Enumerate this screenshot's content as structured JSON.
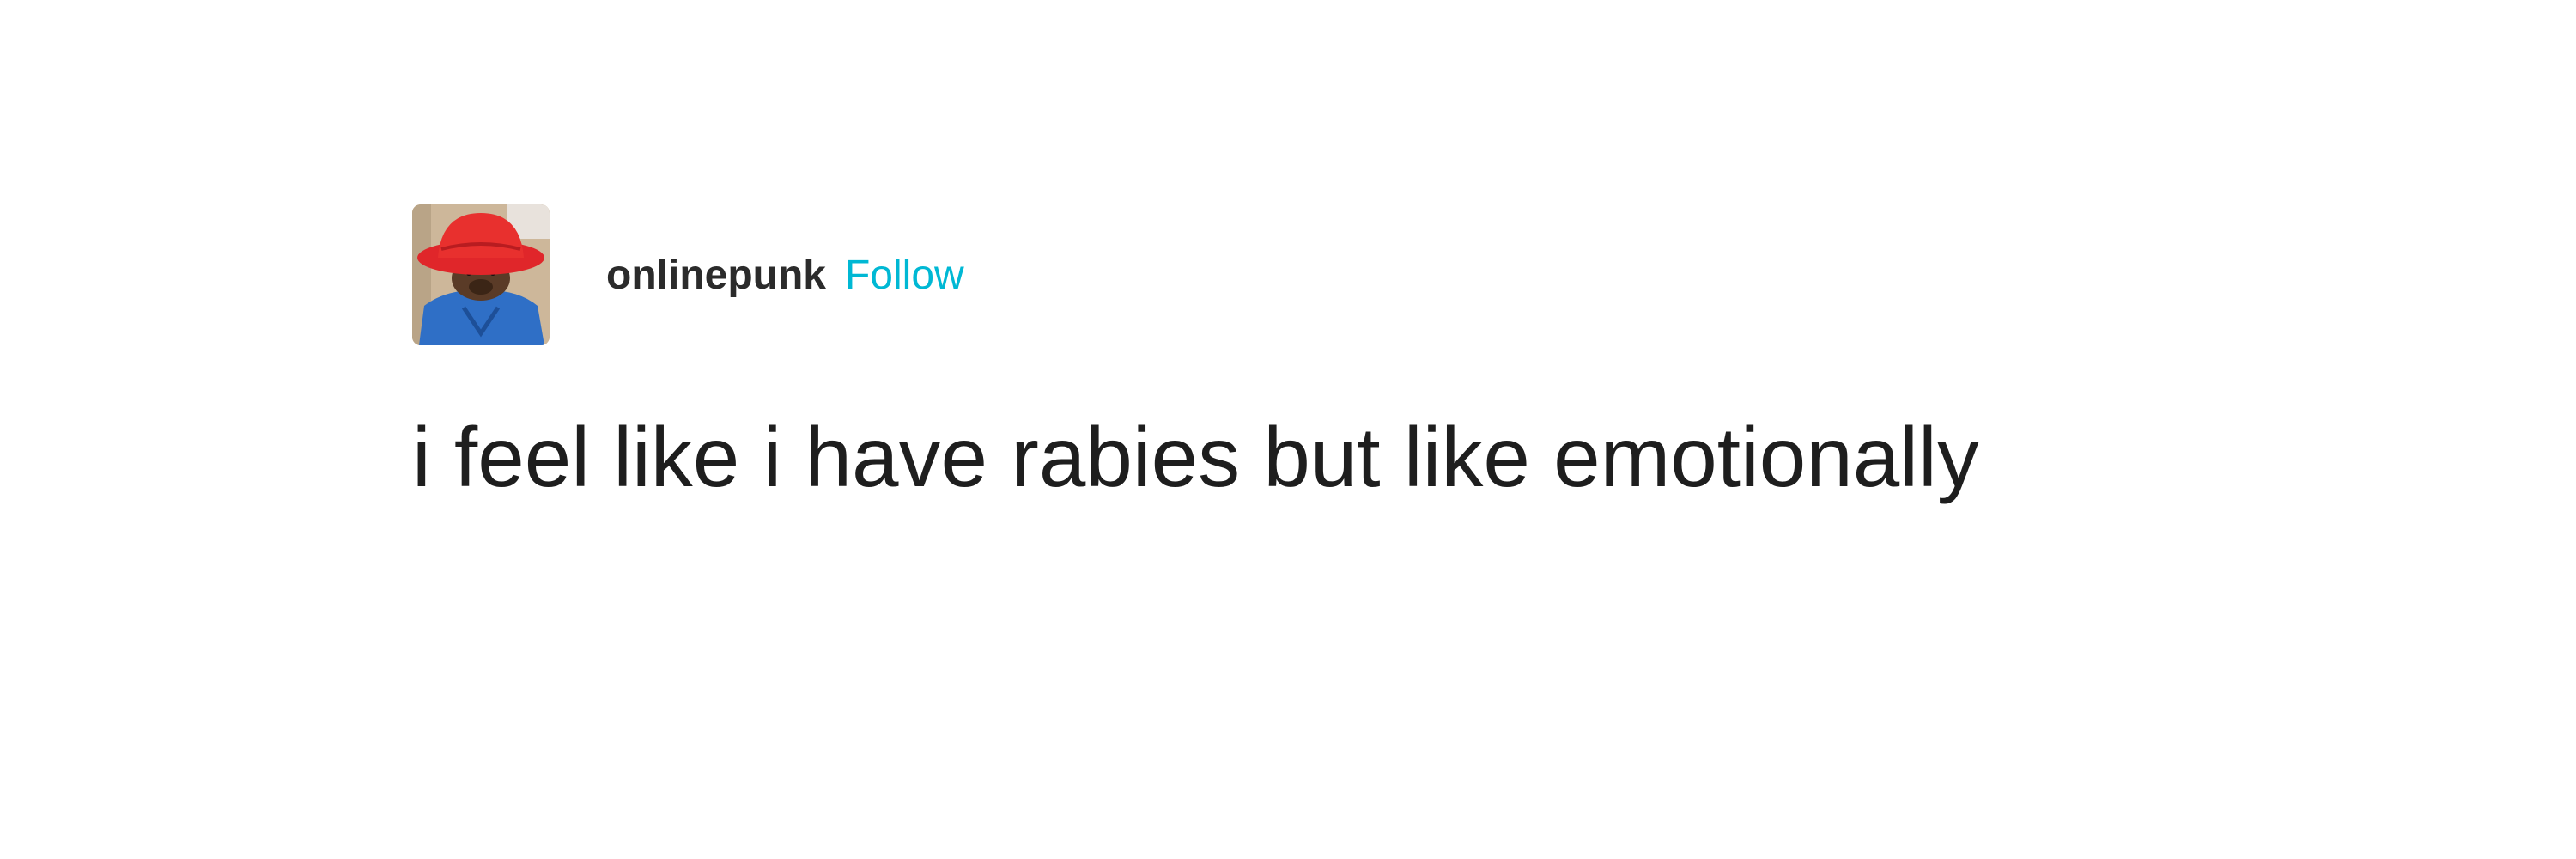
{
  "post": {
    "author": {
      "avatar_icon": "paddington-bear-avatar-icon",
      "username": "onlinepunk",
      "follow_label": "Follow",
      "follow_color": "#00b8d4"
    },
    "body_text": "i feel like i have rabies but like emotionally"
  }
}
